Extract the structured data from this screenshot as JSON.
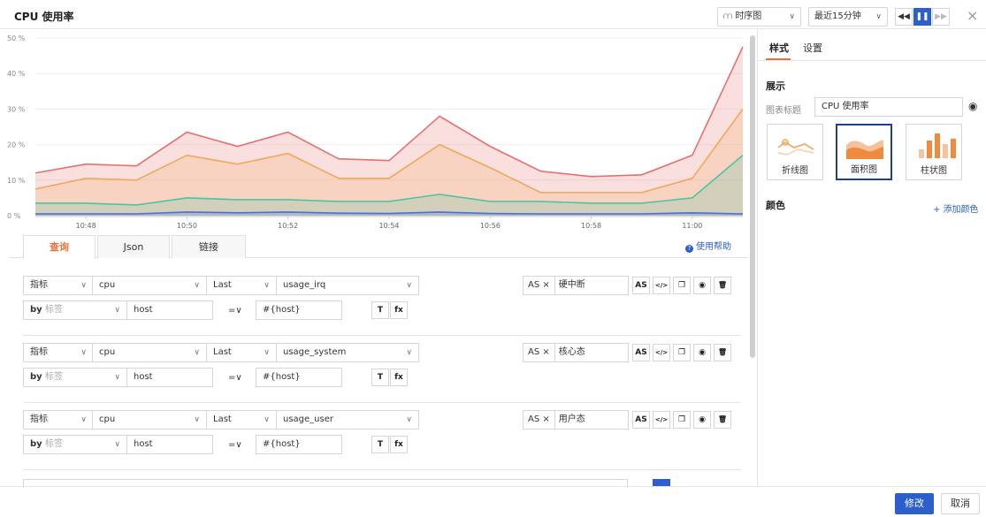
{
  "header": {
    "title": "CPU 使用率",
    "chart_type_select": "时序图",
    "time_range_select": "最近15分钟",
    "close_glyph": "×"
  },
  "chart_data": {
    "type": "area",
    "x": [
      "10:47",
      "10:48",
      "10:49",
      "10:50",
      "10:51",
      "10:52",
      "10:53",
      "10:54",
      "10:55",
      "10:56",
      "10:57",
      "10:58",
      "10:59",
      "11:00",
      "11:01"
    ],
    "x_tick_labels": [
      "10:48",
      "10:50",
      "10:52",
      "10:54",
      "10:56",
      "10:58",
      "11:00"
    ],
    "y_tick_labels": [
      "0 %",
      "10 %",
      "20 %",
      "30 %",
      "40 %",
      "50 %"
    ],
    "ylim": [
      0,
      50
    ],
    "grid": true,
    "series": [
      {
        "color": "#e76f6f",
        "values": [
          12,
          14.5,
          14,
          23.5,
          19.5,
          23.5,
          16,
          15.5,
          28,
          19.5,
          12.5,
          11,
          11.5,
          17,
          47.5
        ]
      },
      {
        "color": "#f0a85a",
        "values": [
          7.5,
          10.5,
          10,
          17,
          14.5,
          17.5,
          10.5,
          10.5,
          20,
          13.5,
          6.5,
          6.5,
          6.5,
          10.5,
          30
        ]
      },
      {
        "color": "#4fc3a1",
        "values": [
          3.5,
          3.5,
          3,
          5,
          4.5,
          4.5,
          4,
          4,
          6,
          4,
          4,
          3.5,
          3.5,
          5,
          17
        ]
      },
      {
        "color": "#4a6fd8",
        "values": [
          0.5,
          0.5,
          0.5,
          1,
          0.8,
          1,
          0.7,
          0.6,
          1,
          0.6,
          0.5,
          0.5,
          0.5,
          0.8,
          0.5
        ]
      }
    ]
  },
  "query_tabs": [
    "查询",
    "Json",
    "链接"
  ],
  "help_label": "使用帮助",
  "queries": [
    {
      "type": "指标",
      "measurement": "cpu",
      "agg": "Last",
      "field": "usage_irq",
      "by": "by",
      "tag_placeholder": "标签",
      "tag_key": "host",
      "op": "=∨",
      "tag_value": "#{host}",
      "as_label": "AS ×",
      "alias": "硬中断"
    },
    {
      "type": "指标",
      "measurement": "cpu",
      "agg": "Last",
      "field": "usage_system",
      "by": "by",
      "tag_placeholder": "标签",
      "tag_key": "host",
      "op": "=∨",
      "tag_value": "#{host}",
      "as_label": "AS ×",
      "alias": "核心态"
    },
    {
      "type": "指标",
      "measurement": "cpu",
      "agg": "Last",
      "field": "usage_user",
      "by": "by",
      "tag_placeholder": "标签",
      "tag_key": "host",
      "op": "=∨",
      "tag_value": "#{host}",
      "as_label": "AS ×",
      "alias": "用户态"
    }
  ],
  "row_buttons": {
    "as": "AS",
    "code": "</>",
    "copy": "❐",
    "eye": "◉",
    "trash": "🗑",
    "filter": "T",
    "fx": "fx"
  },
  "right_panel": {
    "tabs": [
      "样式",
      "设置"
    ],
    "display_section": "展示",
    "title_label": "图表标题",
    "title_value": "CPU 使用率",
    "chart_types": [
      "折线图",
      "面积图",
      "柱状图"
    ],
    "color_section": "颜色",
    "add_color": "+ 添加颜色"
  },
  "footer": {
    "confirm": "修改",
    "cancel": "取消"
  }
}
